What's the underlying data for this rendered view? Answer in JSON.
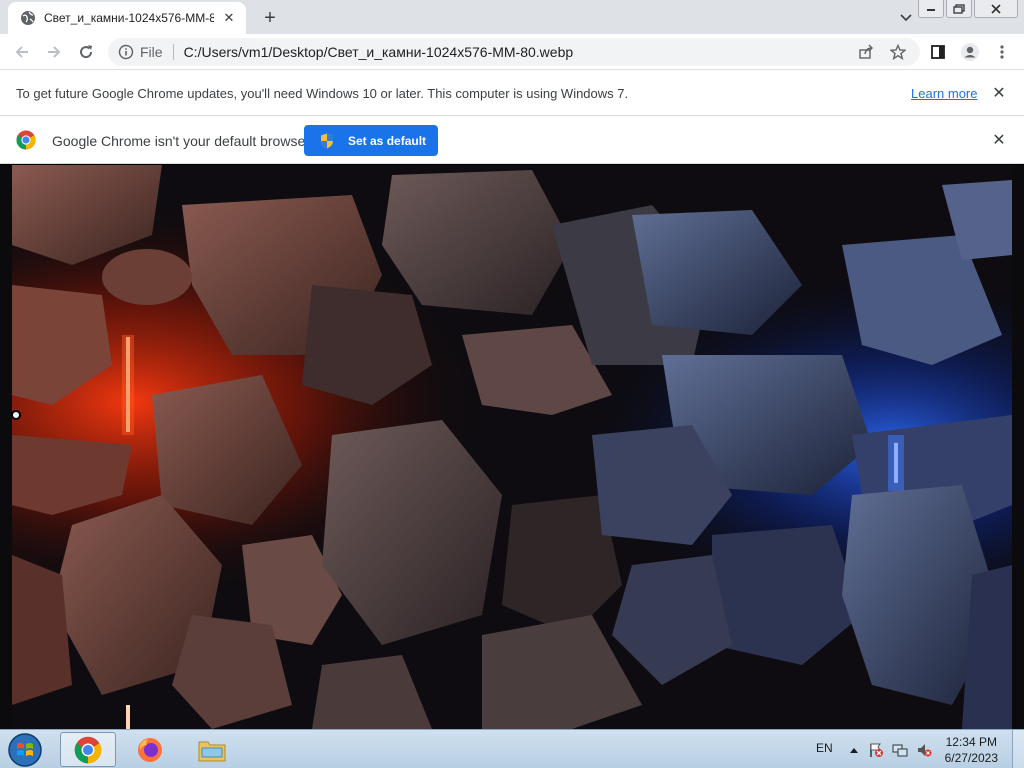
{
  "browser": {
    "tab": {
      "title": "Свет_и_камни-1024x576-MM-80.webp",
      "favicon": "globe-icon"
    },
    "address": {
      "scheme": "File",
      "url": "C:/Users/vm1/Desktop/Свет_и_камни-1024x576-MM-80.webp"
    }
  },
  "infobars": {
    "update": {
      "message": "To get future Google Chrome updates, you'll need Windows 10 or later. This computer is using Windows 7.",
      "link": "Learn more"
    },
    "default_browser": {
      "message": "Google Chrome isn't your default browser",
      "button": "Set as default"
    }
  },
  "content": {
    "image": "glowing-stones-photo",
    "colors": {
      "accent": "#1a73e8",
      "left_glow": "#ff3a10",
      "right_glow": "#1f5bff"
    }
  },
  "taskbar": {
    "apps": [
      "chrome",
      "firefox",
      "file-explorer"
    ],
    "language": "EN",
    "time": "12:34 PM",
    "date": "6/27/2023"
  }
}
